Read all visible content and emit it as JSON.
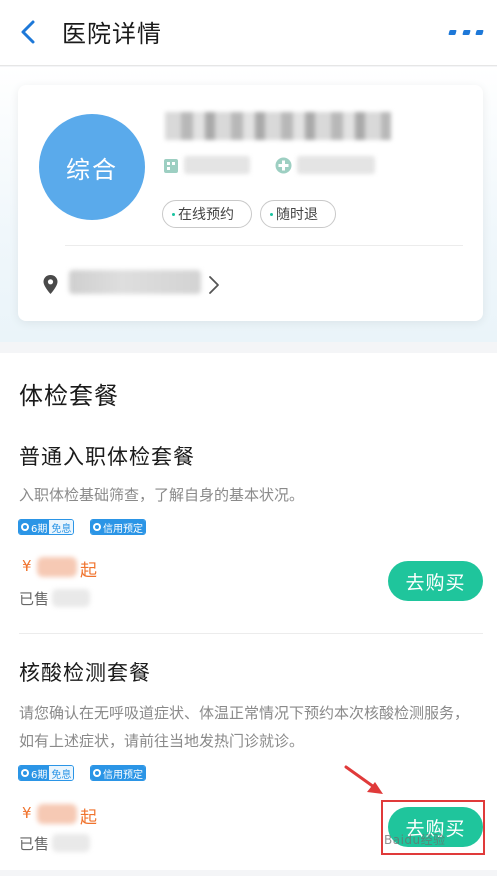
{
  "header": {
    "title": "医院详情",
    "back_icon": "chevron-left-icon",
    "more_icon": "more-dots-icon"
  },
  "hospital": {
    "avatar_label": "综合",
    "tags": [
      "在线预约",
      "随时退"
    ],
    "icons": [
      "hospital-level-icon",
      "hospital-type-icon",
      "location-pin-icon",
      "chevron-right-icon"
    ]
  },
  "section": {
    "title": "体检套餐",
    "packages": [
      {
        "title": "普通入职体检套餐",
        "description": "入职体检基础筛查，了解自身的基本状况。",
        "badge_installment": "6期",
        "badge_installment_sub": "免息",
        "badge_credit": "信用预定",
        "price_symbol": "¥",
        "price_suffix": "起",
        "sold_label": "已售",
        "buy_label": "去购买"
      },
      {
        "title": "核酸检测套餐",
        "description": "请您确认在无呼吸道症状、体温正常情况下预约本次核酸检测服务，如有上述症状，请前往当地发热门诊就诊。",
        "badge_installment": "6期",
        "badge_installment_sub": "免息",
        "badge_credit": "信用预定",
        "price_symbol": "¥",
        "price_suffix": "起",
        "sold_label": "已售",
        "buy_label": "去购买"
      }
    ]
  },
  "annotation": {
    "color": "#e03a3a"
  },
  "watermark": "Baidu经验",
  "colors": {
    "accent_blue": "#1d78d8",
    "avatar_blue": "#5aaaeb",
    "buy_green": "#1fc59c",
    "price_orange": "#f0732d"
  }
}
